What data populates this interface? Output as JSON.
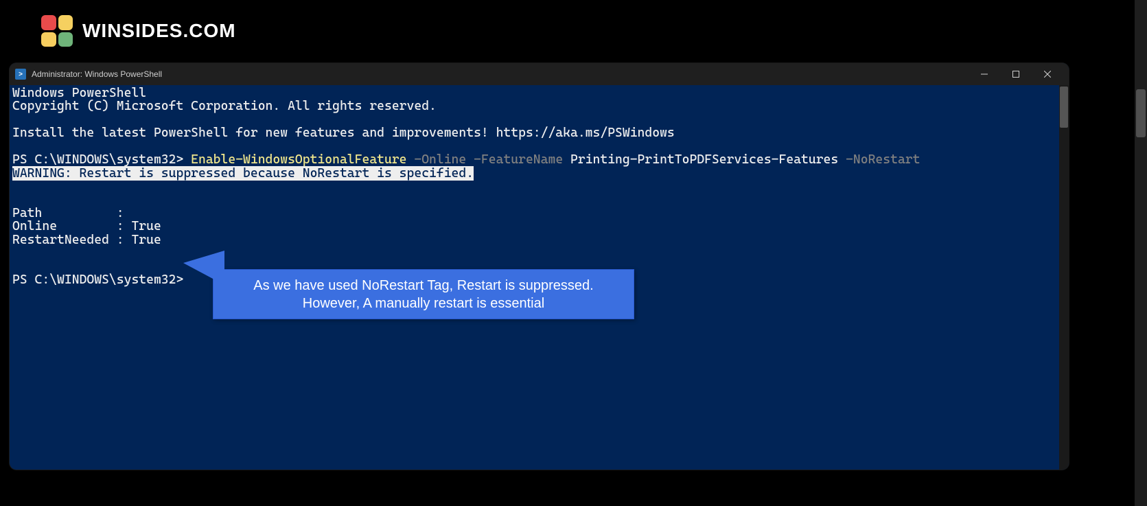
{
  "branding": {
    "text": "WINSIDES.COM"
  },
  "window": {
    "title": "Administrator: Windows PowerShell"
  },
  "terminal": {
    "header1": "Windows PowerShell",
    "header2": "Copyright (C) Microsoft Corporation. All rights reserved.",
    "install_msg": "Install the latest PowerShell for new features and improvements! https://aka.ms/PSWindows",
    "prompt1": "PS C:\\WINDOWS\\system32> ",
    "cmd_cmdlet": "Enable-WindowsOptionalFeature",
    "cmd_p1": " -Online ",
    "cmd_p2": "-FeatureName ",
    "cmd_arg": "Printing-PrintToPDFServices-Features",
    "cmd_p3": " -NoRestart",
    "warning": "WARNING: Restart is suppressed because NoRestart is specified.",
    "out_path_label": "Path          :",
    "out_path_value": "",
    "out_online_label": "Online        : ",
    "out_online_value": "True",
    "out_restart_label": "RestartNeeded : ",
    "out_restart_value": "True",
    "prompt2": "PS C:\\WINDOWS\\system32>"
  },
  "callout": {
    "line1": "As we have used NoRestart Tag, Restart is suppressed.",
    "line2": "However, A manually restart is essential"
  }
}
